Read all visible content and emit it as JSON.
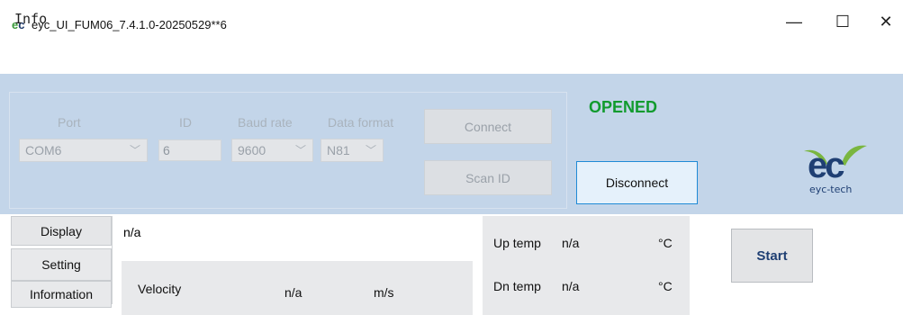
{
  "window": {
    "title": "eyc_UI_FUM06_7.4.1.0-20250529**6",
    "icon_text": "ec",
    "minimize": "—",
    "maximize": "☐",
    "close": "✕"
  },
  "menu": {
    "info": "Info"
  },
  "connection": {
    "port_label": "Port",
    "port_value": "COM6",
    "id_label": "ID",
    "id_value": "6",
    "baud_label": "Baud rate",
    "baud_value": "9600",
    "format_label": "Data format",
    "format_value": "N81",
    "connect_button": "Connect",
    "scan_button": "Scan ID",
    "status": "OPENED",
    "disconnect_button": "Disconnect"
  },
  "logo": {
    "mark_e": "e",
    "mark_c": "c",
    "text": "eyc-tech"
  },
  "colors": {
    "panel": "#c3d5e9",
    "status": "#119b2e",
    "brand": "#1f3f73"
  },
  "tabs": [
    "Display",
    "Setting",
    "Information"
  ],
  "display": {
    "value": "n/a",
    "velocity_label": "Velocity",
    "velocity_value": "n/a",
    "velocity_unit": "m/s"
  },
  "temps": {
    "up_label": "Up temp",
    "up_value": "n/a",
    "up_unit": "°C",
    "dn_label": "Dn temp",
    "dn_value": "n/a",
    "dn_unit": "°C"
  },
  "start_button": "Start"
}
